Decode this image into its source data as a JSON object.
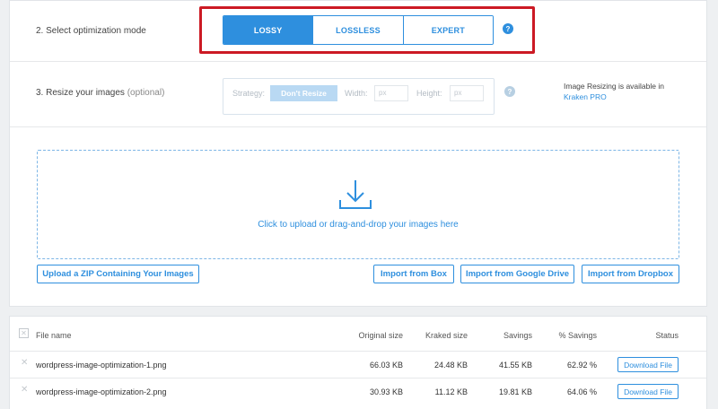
{
  "optimization": {
    "label": "2. Select optimization mode",
    "modes": [
      "LOSSY",
      "LOSSLESS",
      "EXPERT"
    ],
    "active_mode": "LOSSY",
    "help": "?"
  },
  "resize": {
    "label": "3. Resize your images",
    "label_optional": "(optional)",
    "strategy_label": "Strategy:",
    "strategy_value": "Don't Resize",
    "width_label": "Width:",
    "width_placeholder": "px",
    "height_label": "Height:",
    "height_placeholder": "px",
    "help": "?",
    "pro_note": "Image Resizing is available in",
    "pro_link": "Kraken PRO"
  },
  "upload": {
    "icon": "download-arrow-icon",
    "dropzone_text": "Click to upload or drag-and-drop your images here",
    "zip_button": "Upload a ZIP Containing Your Images",
    "box_button": "Import from Box",
    "gdrive_button": "Import from Google Drive",
    "dropbox_button": "Import from Dropbox"
  },
  "results": {
    "columns": {
      "file_name": "File name",
      "original": "Original size",
      "kraked": "Kraked size",
      "savings": "Savings",
      "pct": "% Savings",
      "status": "Status"
    },
    "rows": [
      {
        "file": "wordpress-image-optimization-1.png",
        "original": "66.03 KB",
        "kraked": "24.48 KB",
        "savings": "41.55 KB",
        "pct": "62.92 %",
        "action": "Download File"
      },
      {
        "file": "wordpress-image-optimization-2.png",
        "original": "30.93 KB",
        "kraked": "11.12 KB",
        "savings": "19.81 KB",
        "pct": "64.06 %",
        "action": "Download File"
      }
    ]
  },
  "colors": {
    "accent": "#2e8fde",
    "highlight": "#cc1a24"
  }
}
